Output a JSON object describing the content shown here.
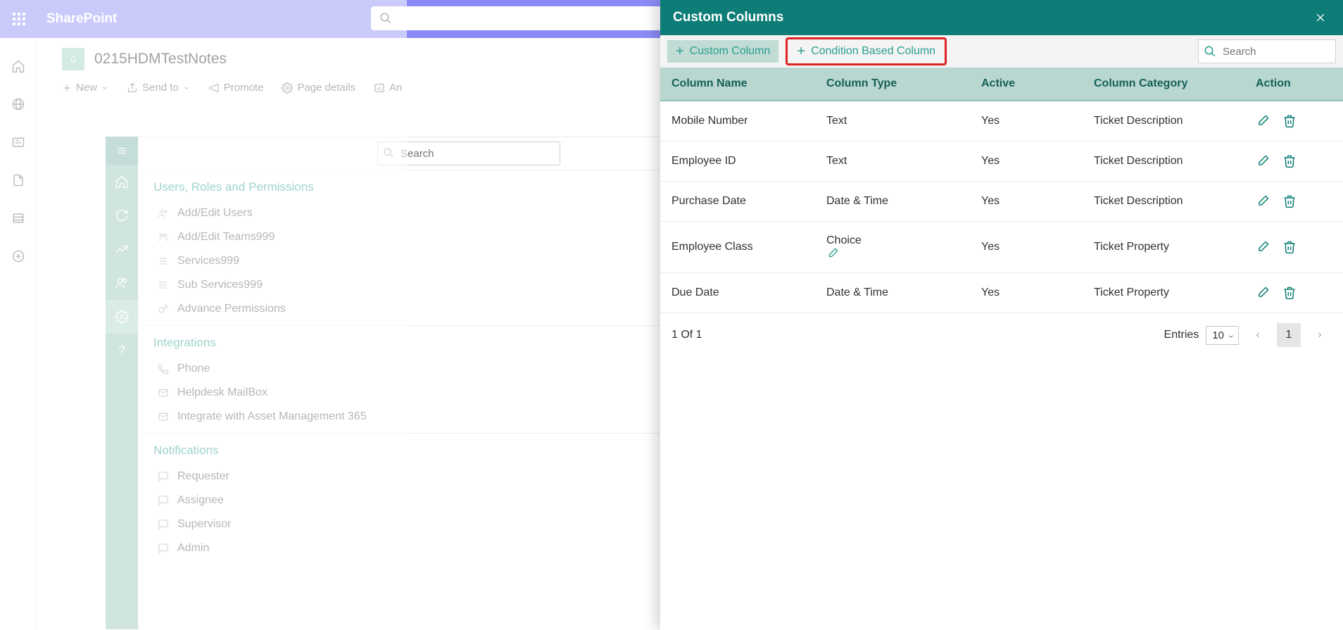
{
  "app": {
    "brand": "SharePoint"
  },
  "sp_search": {
    "placeholder": ""
  },
  "site": {
    "logo_letter": "0",
    "title": "0215HDMTestNotes"
  },
  "cmd": {
    "new": "New",
    "send": "Send to",
    "promote": "Promote",
    "page_details": "Page details",
    "analytics": "An"
  },
  "hd": {
    "search_placeholder": "Search",
    "sections": [
      {
        "title": "Users, Roles and Permissions",
        "items": [
          "Add/Edit Users",
          "Add/Edit Teams999",
          "Services999",
          "Sub Services999",
          "Advance Permissions"
        ]
      },
      {
        "title": "Integrations",
        "items": [
          "Phone",
          "Helpdesk MailBox",
          "Integrate with Asset Management 365"
        ]
      },
      {
        "title": "Notifications",
        "items": [
          "Requester",
          "Assignee",
          "Supervisor",
          "Admin"
        ]
      }
    ]
  },
  "panel": {
    "title": "Custom Columns",
    "btn_custom": "Custom Column",
    "btn_condition": "Condition Based Column",
    "search_placeholder": "Search",
    "headers": {
      "name": "Column Name",
      "type": "Column Type",
      "active": "Active",
      "category": "Column Category",
      "action": "Action"
    },
    "rows": [
      {
        "name": "Mobile Number",
        "type": "Text",
        "active": "Yes",
        "category": "Ticket Description",
        "choice_edit": false
      },
      {
        "name": "Employee ID",
        "type": "Text",
        "active": "Yes",
        "category": "Ticket Description",
        "choice_edit": false
      },
      {
        "name": "Purchase Date",
        "type": "Date & Time",
        "active": "Yes",
        "category": "Ticket Description",
        "choice_edit": false
      },
      {
        "name": "Employee Class",
        "type": "Choice",
        "active": "Yes",
        "category": "Ticket Property",
        "choice_edit": true
      },
      {
        "name": "Due Date",
        "type": "Date & Time",
        "active": "Yes",
        "category": "Ticket Property",
        "choice_edit": false
      }
    ],
    "pager": {
      "status": "1 Of 1",
      "entries_label": "Entries",
      "entries_value": "10",
      "current_page": "1"
    }
  }
}
